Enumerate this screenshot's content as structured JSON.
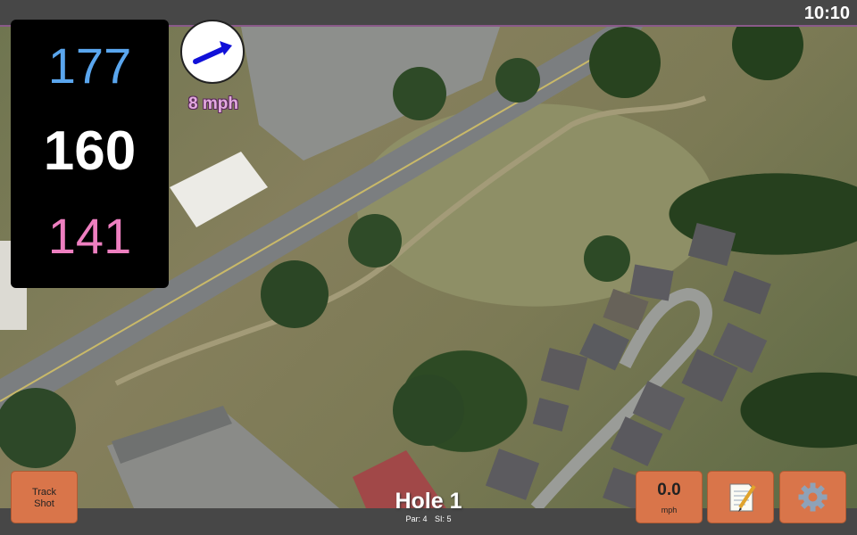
{
  "status": {
    "time": "10:10"
  },
  "distances": {
    "back": "177",
    "middle": "160",
    "front": "141"
  },
  "wind": {
    "speed": "8 mph",
    "icon": "arrow-right-icon"
  },
  "hole": {
    "title": "Hole 1",
    "par": "Par: 4",
    "si": "SI: 5"
  },
  "buttons": {
    "track_shot": {
      "line1": "Track",
      "line2": "Shot"
    },
    "speed": {
      "value": "0.0",
      "unit": "mph"
    },
    "notes_icon": "notepad-icon",
    "settings_icon": "gear-icon"
  },
  "colors": {
    "back_distance": "#5aa6ee",
    "middle_distance": "#ffffff",
    "front_distance": "#ee7fc0",
    "button": "#d9754a",
    "wind_text": "#e3a9e0"
  }
}
